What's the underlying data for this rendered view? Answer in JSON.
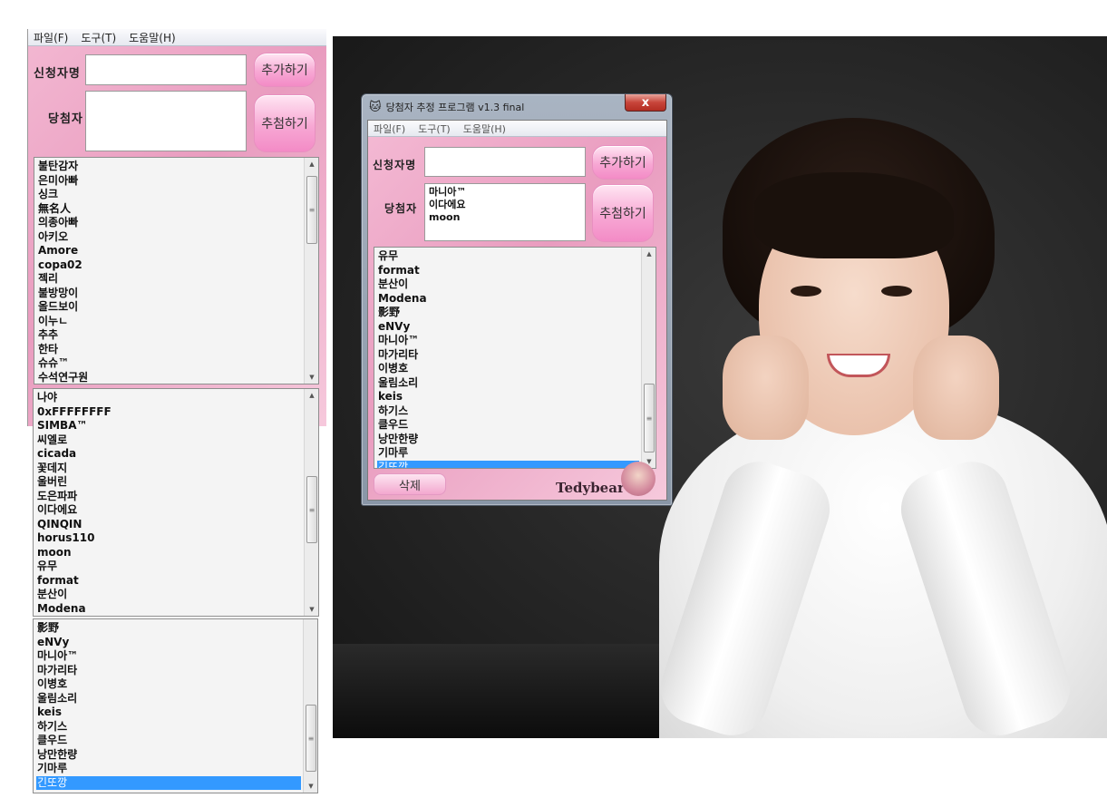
{
  "menu": {
    "file": "파일(F)",
    "tools": "도구(T)",
    "help": "도움말(H)"
  },
  "labels": {
    "applicant": "신청자명",
    "winner": "당첨자"
  },
  "buttons": {
    "add": "추가하기",
    "draw": "추첨하기",
    "delete": "삭제"
  },
  "window": {
    "title": "당첨자 추정 프로그램 v1.3 final",
    "close": "x"
  },
  "winners": [
    "마니아™",
    "이다에요",
    "moon"
  ],
  "left_list_1": [
    "불탄감자",
    "은미아빠",
    "싱크",
    "無名人",
    "의종아빠",
    "아키오",
    "Amore",
    "copa02",
    "젝리",
    "불방망이",
    "올드보이",
    "이누ㄴ",
    "추추",
    "한타",
    "슈슈™",
    "수석연구원"
  ],
  "left_list_2": [
    "나야",
    "0xFFFFFFFF",
    "SIMBA™",
    "씨엘로",
    "cicada",
    "꽃데지",
    "울버린",
    "도은파파",
    "이다에요",
    "QINQIN",
    "horus110",
    "moon",
    "유무",
    "format",
    "분산이",
    "Modena"
  ],
  "left_list_3": [
    "影野",
    "eNVy",
    "마니아™",
    "마가리타",
    "이병호",
    "울림소리",
    "keis",
    "하기스",
    "클우드",
    "낭만한량",
    "기마루",
    "긴또깡"
  ],
  "window_list": [
    "유무",
    "format",
    "분산이",
    "Modena",
    "影野",
    "eNVy",
    "마니아™",
    "마가리타",
    "이병호",
    "울림소리",
    "keis",
    "하기스",
    "클우드",
    "낭만한량",
    "기마루",
    "긴또깡"
  ],
  "selected_item": "긴또깡",
  "logo": "Tedybear",
  "icons": {
    "window": "cat-icon",
    "scroll_up": "scroll-up-icon",
    "scroll_down": "scroll-down-icon",
    "thumb_grip": "grip-icon"
  },
  "colors": {
    "pink_bg": "#e99cbf",
    "selection": "#3399ff",
    "close_red": "#c8453a"
  }
}
